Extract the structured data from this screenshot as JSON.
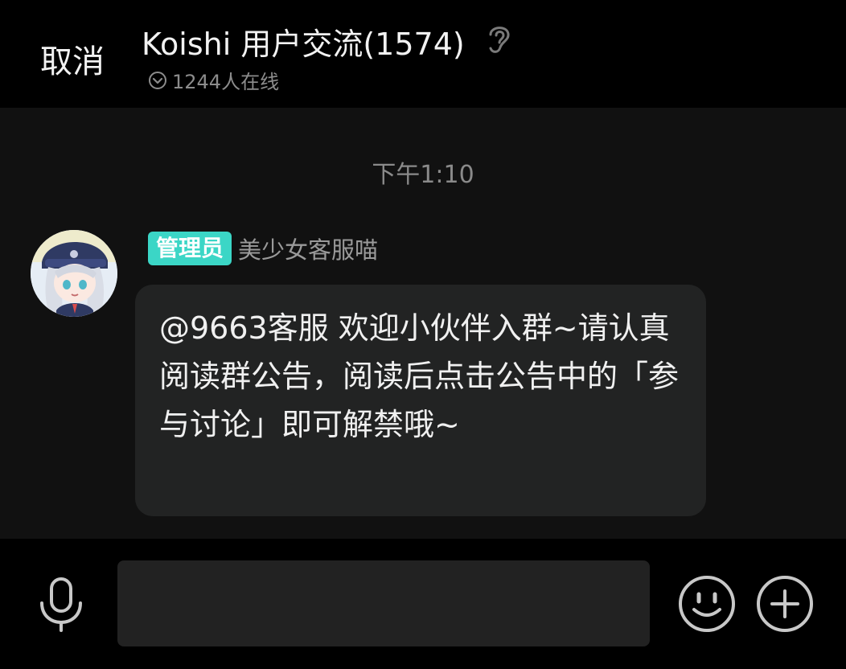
{
  "header": {
    "cancel_label": "取消",
    "title": "Koishi 用户交流(1574)",
    "online_text": "1244人在线",
    "icons": [
      "ear-icon",
      "chevron-down-circle-icon"
    ]
  },
  "chat": {
    "timestamp": "下午1:10",
    "messages": [
      {
        "role_badge": "管理员",
        "sender": "美少女客服喵",
        "text": "@9663客服 欢迎小伙伴入群~请认真阅读群公告，阅读后点击公告中的「参与讨论」即可解禁哦~",
        "avatar_icon": "avatar-image"
      }
    ]
  },
  "input_bar": {
    "placeholder": "",
    "value": "",
    "icons": [
      "microphone-icon",
      "emoji-icon",
      "plus-icon"
    ]
  },
  "colors": {
    "header_bg": "#000000",
    "chat_bg": "#111111",
    "bubble_bg": "#222323",
    "badge_bg": "#3bd6c6"
  }
}
